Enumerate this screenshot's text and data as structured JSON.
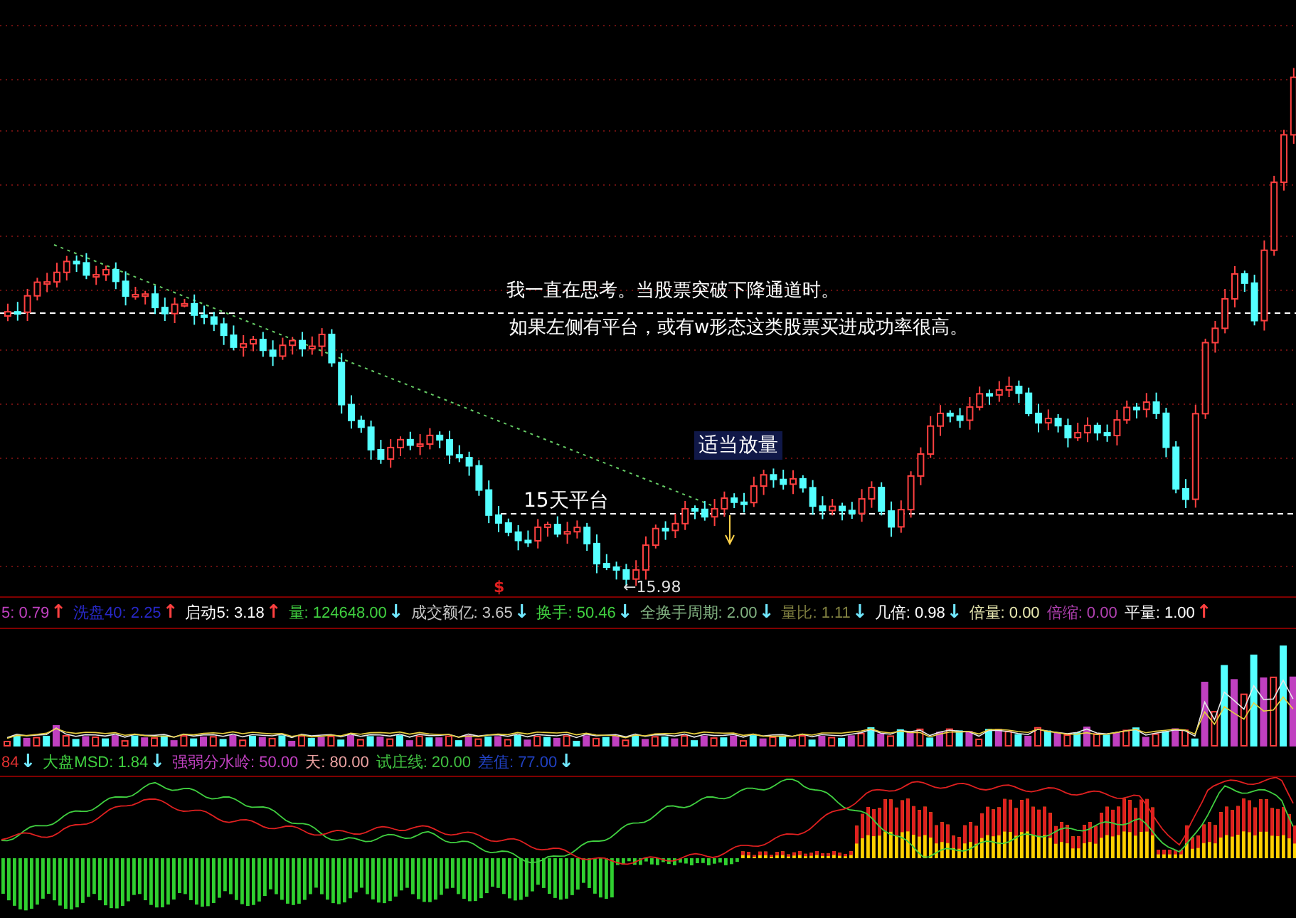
{
  "main_chart": {
    "annotations": [
      {
        "kind": "note",
        "text": "我一直在思考。当股票突破下降通道时。"
      },
      {
        "kind": "note",
        "text": "如果左侧有平台，或有w形态这类股票买进成功率很高。"
      },
      {
        "kind": "label",
        "text": "15天平台"
      },
      {
        "kind": "badge",
        "text": "适当放量"
      },
      {
        "kind": "price",
        "text": "←15.98"
      },
      {
        "kind": "signal",
        "text": "$"
      }
    ]
  },
  "indicator_bar_1": [
    {
      "text": "5: 0.79",
      "color": "#c040c0",
      "arrow": {
        "text": "↑",
        "color": "#ff4040"
      }
    },
    {
      "text": "洗盘40: 2.25",
      "color": "#2828c8",
      "arrow": {
        "text": "↑",
        "color": "#ff4040"
      }
    },
    {
      "text": "启动5: 3.18",
      "color": "#ffffff",
      "arrow": {
        "text": "↑",
        "color": "#ff4040"
      }
    },
    {
      "text": "量: 124648.00",
      "color": "#40d040",
      "arrow": {
        "text": "↓",
        "color": "#70e8ff"
      }
    },
    {
      "text": "成交额亿: 3.65",
      "color": "#c8c8c8",
      "arrow": {
        "text": "↓",
        "color": "#70e8ff"
      }
    },
    {
      "text": "换手: 50.46",
      "color": "#40d040",
      "arrow": {
        "text": "↓",
        "color": "#70e8ff"
      }
    },
    {
      "text": "全换手周期: 2.00",
      "color": "#80b080",
      "arrow": {
        "text": "↓",
        "color": "#70e8ff"
      }
    },
    {
      "text": "量比: 1.11",
      "color": "#808040",
      "arrow": {
        "text": "↓",
        "color": "#70e8ff"
      }
    },
    {
      "text": "几倍: 0.98",
      "color": "#ffffff",
      "arrow": {
        "text": "↓",
        "color": "#70e8ff"
      }
    },
    {
      "text": "倍量: 0.00",
      "color": "#e8e8b0"
    },
    {
      "text": "倍缩: 0.00",
      "color": "#b040b0"
    },
    {
      "text": "平量: 1.00",
      "color": "#ffffff",
      "arrow": {
        "text": "↑",
        "color": "#ff4040"
      }
    }
  ],
  "indicator_bar_2": [
    {
      "text": "84",
      "color": "#e03030",
      "arrow": {
        "text": "↓",
        "color": "#70e8ff"
      }
    },
    {
      "text": "大盘MSD: 1.84",
      "color": "#40d040",
      "arrow": {
        "text": "↓",
        "color": "#70e8ff"
      }
    },
    {
      "text": "强弱分水岭: 50.00",
      "color": "#c040c0"
    },
    {
      "text": "天: 80.00",
      "color": "#e8a0a0"
    },
    {
      "text": "试庄线: 20.00",
      "color": "#40c040"
    },
    {
      "text": "差值: 77.00",
      "color": "#2040c0",
      "arrow": {
        "text": "↓",
        "color": "#70e8ff"
      }
    }
  ]
}
